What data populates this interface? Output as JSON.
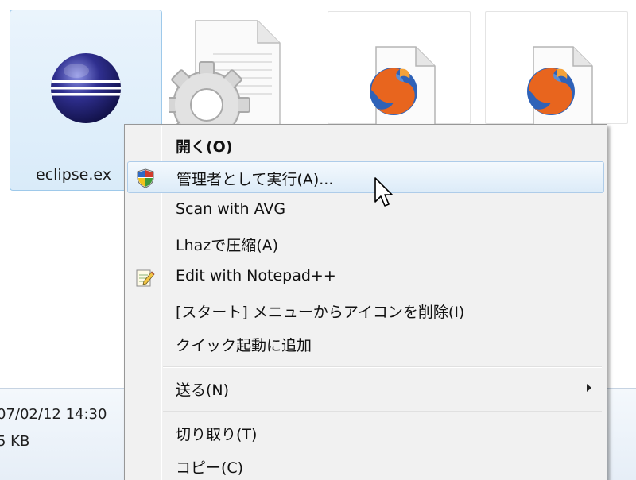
{
  "files": [
    {
      "name": "eclipse.ex",
      "icon": "eclipse-icon",
      "selected": true
    },
    {
      "name": "",
      "icon": "settings-file-icon",
      "selected": false
    },
    {
      "name": "",
      "icon": "firefox-document-icon",
      "selected": false
    },
    {
      "name": "",
      "icon": "firefox-document-icon",
      "selected": false
    }
  ],
  "details": {
    "date": "07/02/12 14:30",
    "size": "5 KB"
  },
  "context_menu": {
    "items": [
      {
        "label": "開く(O)",
        "bold": true,
        "icon": null
      },
      {
        "label": "管理者として実行(A)...",
        "icon": "uac-shield-icon",
        "highlighted": true
      },
      {
        "label": "Scan with AVG",
        "icon": null
      },
      {
        "label": "Lhazで圧縮(A)",
        "icon": null
      },
      {
        "label": "Edit with Notepad++",
        "icon": "notepad-icon"
      },
      {
        "label": "[スタート] メニューからアイコンを削除(I)",
        "icon": null
      },
      {
        "label": "クイック起動に追加",
        "icon": null
      },
      {
        "label": "送る(N)",
        "icon": null,
        "submenu": true
      },
      {
        "label": "切り取り(T)",
        "icon": null
      },
      {
        "label": "コピー(C)",
        "icon": null
      }
    ]
  },
  "colors": {
    "selection": "#d9ebf9",
    "menu_background": "#f1f1f1",
    "highlight_border": "#aecce9"
  }
}
